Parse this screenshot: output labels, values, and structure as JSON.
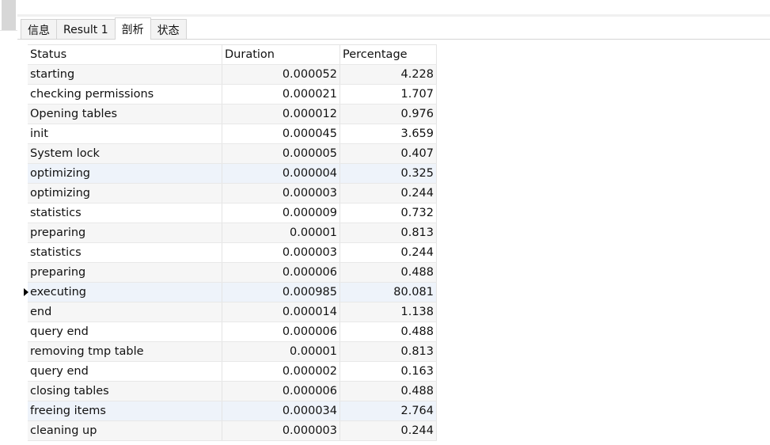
{
  "tabs": [
    "信息",
    "Result 1",
    "剖析",
    "状态"
  ],
  "active_tab": 2,
  "columns": [
    "Status",
    "Duration",
    "Percentage"
  ],
  "rows": [
    {
      "status": "starting",
      "duration": "0.000052",
      "percentage": "4.228"
    },
    {
      "status": "checking permissions",
      "duration": "0.000021",
      "percentage": "1.707"
    },
    {
      "status": "Opening tables",
      "duration": "0.000012",
      "percentage": "0.976"
    },
    {
      "status": "init",
      "duration": "0.000045",
      "percentage": "3.659"
    },
    {
      "status": "System lock",
      "duration": "0.000005",
      "percentage": "0.407"
    },
    {
      "status": "optimizing",
      "duration": "0.000004",
      "percentage": "0.325"
    },
    {
      "status": "optimizing",
      "duration": "0.000003",
      "percentage": "0.244"
    },
    {
      "status": "statistics",
      "duration": "0.000009",
      "percentage": "0.732"
    },
    {
      "status": "preparing",
      "duration": "0.00001",
      "percentage": "0.813"
    },
    {
      "status": "statistics",
      "duration": "0.000003",
      "percentage": "0.244"
    },
    {
      "status": "preparing",
      "duration": "0.000006",
      "percentage": "0.488"
    },
    {
      "status": "executing",
      "duration": "0.000985",
      "percentage": "80.081"
    },
    {
      "status": "end",
      "duration": "0.000014",
      "percentage": "1.138"
    },
    {
      "status": "query end",
      "duration": "0.000006",
      "percentage": "0.488"
    },
    {
      "status": "removing tmp table",
      "duration": "0.00001",
      "percentage": "0.813"
    },
    {
      "status": "query end",
      "duration": "0.000002",
      "percentage": "0.163"
    },
    {
      "status": "closing tables",
      "duration": "0.000006",
      "percentage": "0.488"
    },
    {
      "status": "freeing items",
      "duration": "0.000034",
      "percentage": "2.764"
    },
    {
      "status": "cleaning up",
      "duration": "0.000003",
      "percentage": "0.244"
    }
  ],
  "current_row": 11,
  "highlighted_rows": [
    5,
    11,
    17
  ]
}
